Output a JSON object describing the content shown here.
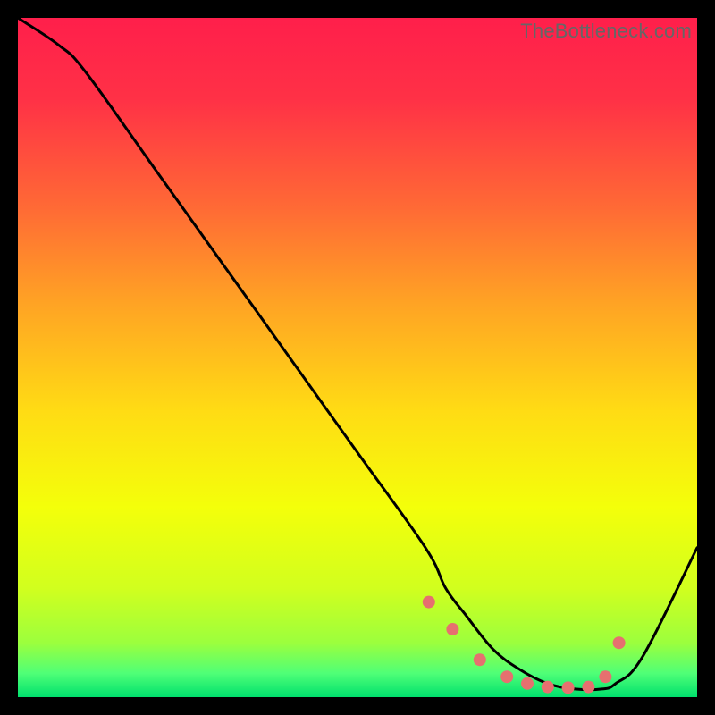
{
  "watermark": "TheBottleneck.com",
  "chart_data": {
    "type": "line",
    "title": "",
    "xlabel": "",
    "ylabel": "",
    "xlim": [
      0,
      100
    ],
    "ylim": [
      0,
      100
    ],
    "series": [
      {
        "name": "curve",
        "x": [
          0,
          6,
          10,
          20,
          30,
          40,
          50,
          60,
          63,
          66,
          70,
          74,
          78,
          82,
          86,
          88,
          92,
          100
        ],
        "values": [
          100,
          96,
          92,
          78,
          64,
          50,
          36,
          22,
          16,
          12,
          7,
          4,
          2,
          1.2,
          1.2,
          2,
          6,
          22
        ]
      }
    ],
    "markers": {
      "x": [
        60.5,
        64,
        68,
        72,
        75,
        78,
        81,
        84,
        86.5,
        88.5
      ],
      "values": [
        14,
        10,
        5.5,
        3,
        2,
        1.5,
        1.4,
        1.5,
        3,
        8
      ],
      "color": "#e6706f",
      "radius": 7
    },
    "background_gradient": {
      "stops": [
        {
          "offset": 0.0,
          "color": "#ff1f4b"
        },
        {
          "offset": 0.12,
          "color": "#ff3146"
        },
        {
          "offset": 0.28,
          "color": "#ff6a35"
        },
        {
          "offset": 0.42,
          "color": "#ffa324"
        },
        {
          "offset": 0.58,
          "color": "#ffdc14"
        },
        {
          "offset": 0.72,
          "color": "#f4ff0a"
        },
        {
          "offset": 0.84,
          "color": "#d1ff1e"
        },
        {
          "offset": 0.92,
          "color": "#9cff3d"
        },
        {
          "offset": 0.965,
          "color": "#4fff77"
        },
        {
          "offset": 1.0,
          "color": "#00e06d"
        }
      ]
    }
  }
}
